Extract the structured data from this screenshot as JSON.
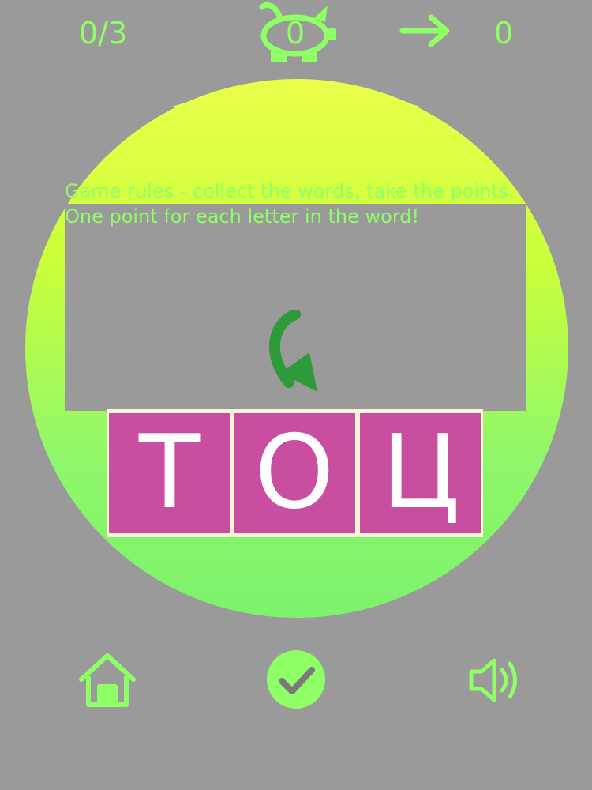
{
  "hud": {
    "progress": "0/3",
    "bank": "0",
    "score": "0"
  },
  "rules": {
    "line1": "Game rules - collect the words, take the points.",
    "line2": "One point for each letter in the word!"
  },
  "tiles": [
    "Т",
    "О",
    "Ц"
  ],
  "colors": {
    "background": "#9a9a9a",
    "accent_green": "#8fff66",
    "tile": "#ca4e9f",
    "arrow": "#2f9a3a"
  },
  "icons": {
    "bank": "piggy-bank-icon",
    "next": "arrow-right-icon",
    "hint": "curved-arrow-icon",
    "home": "home-icon",
    "confirm": "check-icon",
    "sound": "speaker-icon"
  }
}
